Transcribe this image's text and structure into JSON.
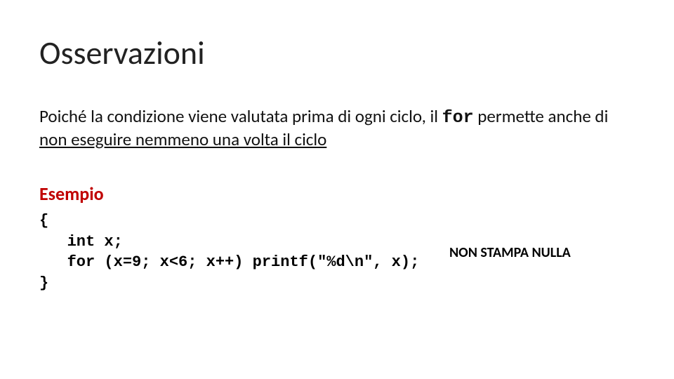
{
  "title": "Osservazioni",
  "body": {
    "prefix": "Poiché la condizione viene valutata prima di ogni ciclo, il ",
    "mono": "for",
    "mid": " permette anche di ",
    "underlined": "non eseguire nemmeno una volta il ciclo"
  },
  "esempio_label": "Esempio",
  "code": "{\n   int x;\n   for (x=9; x<6; x++) printf(\"%d\\n\", x);\n}",
  "note": "NON STAMPA NULLA"
}
